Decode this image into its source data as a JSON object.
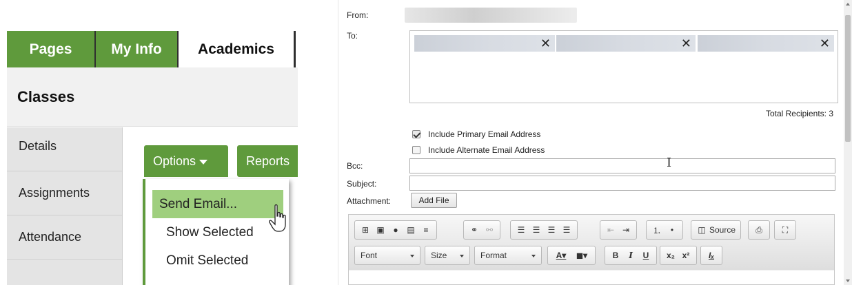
{
  "left": {
    "tabs": [
      {
        "label": "Pages",
        "active": false
      },
      {
        "label": "My Info",
        "active": false
      },
      {
        "label": "Academics",
        "active": true
      }
    ],
    "section_title": "Classes",
    "sidenav": [
      {
        "label": "Details"
      },
      {
        "label": "Assignments"
      },
      {
        "label": "Attendance"
      }
    ],
    "options_label": "Options",
    "reports_label": "Reports",
    "dropdown": [
      {
        "label": "Send Email...",
        "highlighted": true
      },
      {
        "label": "Show Selected",
        "highlighted": false
      },
      {
        "label": "Omit Selected",
        "highlighted": false
      }
    ],
    "accent_color": "#5f9a3c"
  },
  "email": {
    "from_label": "From:",
    "to_label": "To:",
    "remove_symbol": "✕",
    "total_recipients": "Total Recipients: 3",
    "include_primary": {
      "label": "Include Primary Email Address",
      "checked": true
    },
    "include_alternate": {
      "label": "Include Alternate Email Address",
      "checked": false
    },
    "bcc_label": "Bcc:",
    "bcc_value": "",
    "subject_label": "Subject:",
    "subject_value": "",
    "attachment_label": "Attachment:",
    "add_file_label": "Add File",
    "toolbar": {
      "source_label": "Source",
      "font_label": "Font",
      "size_label": "Size",
      "format_label": "Format"
    }
  }
}
